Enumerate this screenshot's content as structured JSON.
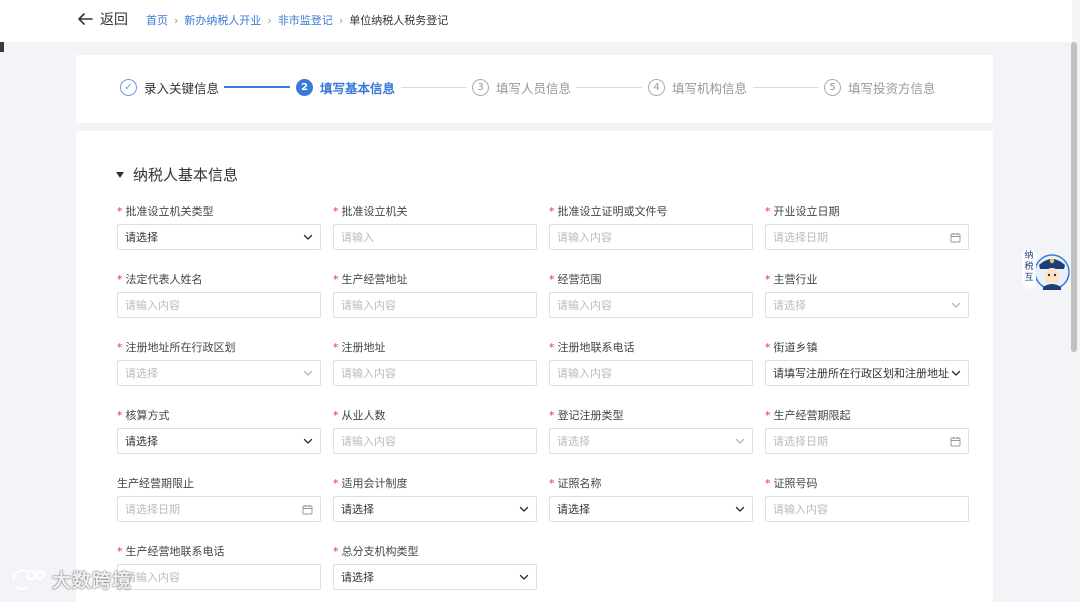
{
  "nav": {
    "back_label": "返回",
    "breadcrumb": [
      "首页",
      "新办纳税人开业",
      "非市监登记",
      "单位纳税人税务登记"
    ]
  },
  "steps": [
    {
      "label": "录入关键信息",
      "number": "✓",
      "status": "done"
    },
    {
      "label": "填写基本信息",
      "number": "2",
      "status": "active"
    },
    {
      "label": "填写人员信息",
      "number": "3",
      "status": "pending"
    },
    {
      "label": "填写机构信息",
      "number": "4",
      "status": "pending"
    },
    {
      "label": "填写投资方信息",
      "number": "5",
      "status": "pending"
    }
  ],
  "section": {
    "title": "纳税人基本信息"
  },
  "fields": [
    {
      "label": "批准设立机关类型",
      "required": true,
      "type": "select",
      "value": "请选择",
      "placeholder": "",
      "disabled": false
    },
    {
      "label": "批准设立机关",
      "required": true,
      "type": "input",
      "value": "",
      "placeholder": "请输入",
      "disabled": false
    },
    {
      "label": "批准设立证明或文件号",
      "required": true,
      "type": "input",
      "value": "",
      "placeholder": "请输入内容",
      "disabled": false
    },
    {
      "label": "开业设立日期",
      "required": true,
      "type": "date",
      "value": "",
      "placeholder": "请选择日期",
      "disabled": false
    },
    {
      "label": "法定代表人姓名",
      "required": true,
      "type": "input",
      "value": "",
      "placeholder": "请输入内容",
      "disabled": false
    },
    {
      "label": "生产经营地址",
      "required": true,
      "type": "input",
      "value": "",
      "placeholder": "请输入内容",
      "disabled": false
    },
    {
      "label": "经营范围",
      "required": true,
      "type": "input",
      "value": "",
      "placeholder": "请输入内容",
      "disabled": false
    },
    {
      "label": "主营行业",
      "required": true,
      "type": "select",
      "value": "",
      "placeholder": "请选择",
      "disabled": true
    },
    {
      "label": "注册地址所在行政区划",
      "required": true,
      "type": "select",
      "value": "",
      "placeholder": "请选择",
      "disabled": true
    },
    {
      "label": "注册地址",
      "required": true,
      "type": "input",
      "value": "",
      "placeholder": "请输入内容",
      "disabled": false
    },
    {
      "label": "注册地联系电话",
      "required": true,
      "type": "input",
      "value": "",
      "placeholder": "请输入内容",
      "disabled": false
    },
    {
      "label": "街道乡镇",
      "required": true,
      "type": "select",
      "value": "请填写注册所在行政区划和注册地址",
      "placeholder": "",
      "disabled": false
    },
    {
      "label": "核算方式",
      "required": true,
      "type": "select",
      "value": "请选择",
      "placeholder": "",
      "disabled": false
    },
    {
      "label": "从业人数",
      "required": true,
      "type": "input",
      "value": "",
      "placeholder": "请输入内容",
      "disabled": false
    },
    {
      "label": "登记注册类型",
      "required": true,
      "type": "select",
      "value": "",
      "placeholder": "请选择",
      "disabled": true
    },
    {
      "label": "生产经营期限起",
      "required": true,
      "type": "date",
      "value": "",
      "placeholder": "请选择日期",
      "disabled": false
    },
    {
      "label": "生产经营期限止",
      "required": false,
      "type": "date",
      "value": "",
      "placeholder": "请选择日期",
      "disabled": false
    },
    {
      "label": "适用会计制度",
      "required": true,
      "type": "select",
      "value": "请选择",
      "placeholder": "",
      "disabled": false
    },
    {
      "label": "证照名称",
      "required": true,
      "type": "select",
      "value": "请选择",
      "placeholder": "",
      "disabled": false
    },
    {
      "label": "证照号码",
      "required": true,
      "type": "input",
      "value": "",
      "placeholder": "请输入内容",
      "disabled": false
    },
    {
      "label": "生产经营地联系电话",
      "required": true,
      "type": "input",
      "value": "",
      "placeholder": "请输入内容",
      "disabled": false
    },
    {
      "label": "总分支机构类型",
      "required": true,
      "type": "select",
      "value": "请选择",
      "placeholder": "",
      "disabled": false
    }
  ],
  "widget": {
    "mascot_text": "纳税互动"
  },
  "watermark": {
    "text": "大数跨境"
  },
  "colors": {
    "accent": "#3a7bd5",
    "required": "#e33333",
    "page_bg": "#f3f4f7"
  }
}
